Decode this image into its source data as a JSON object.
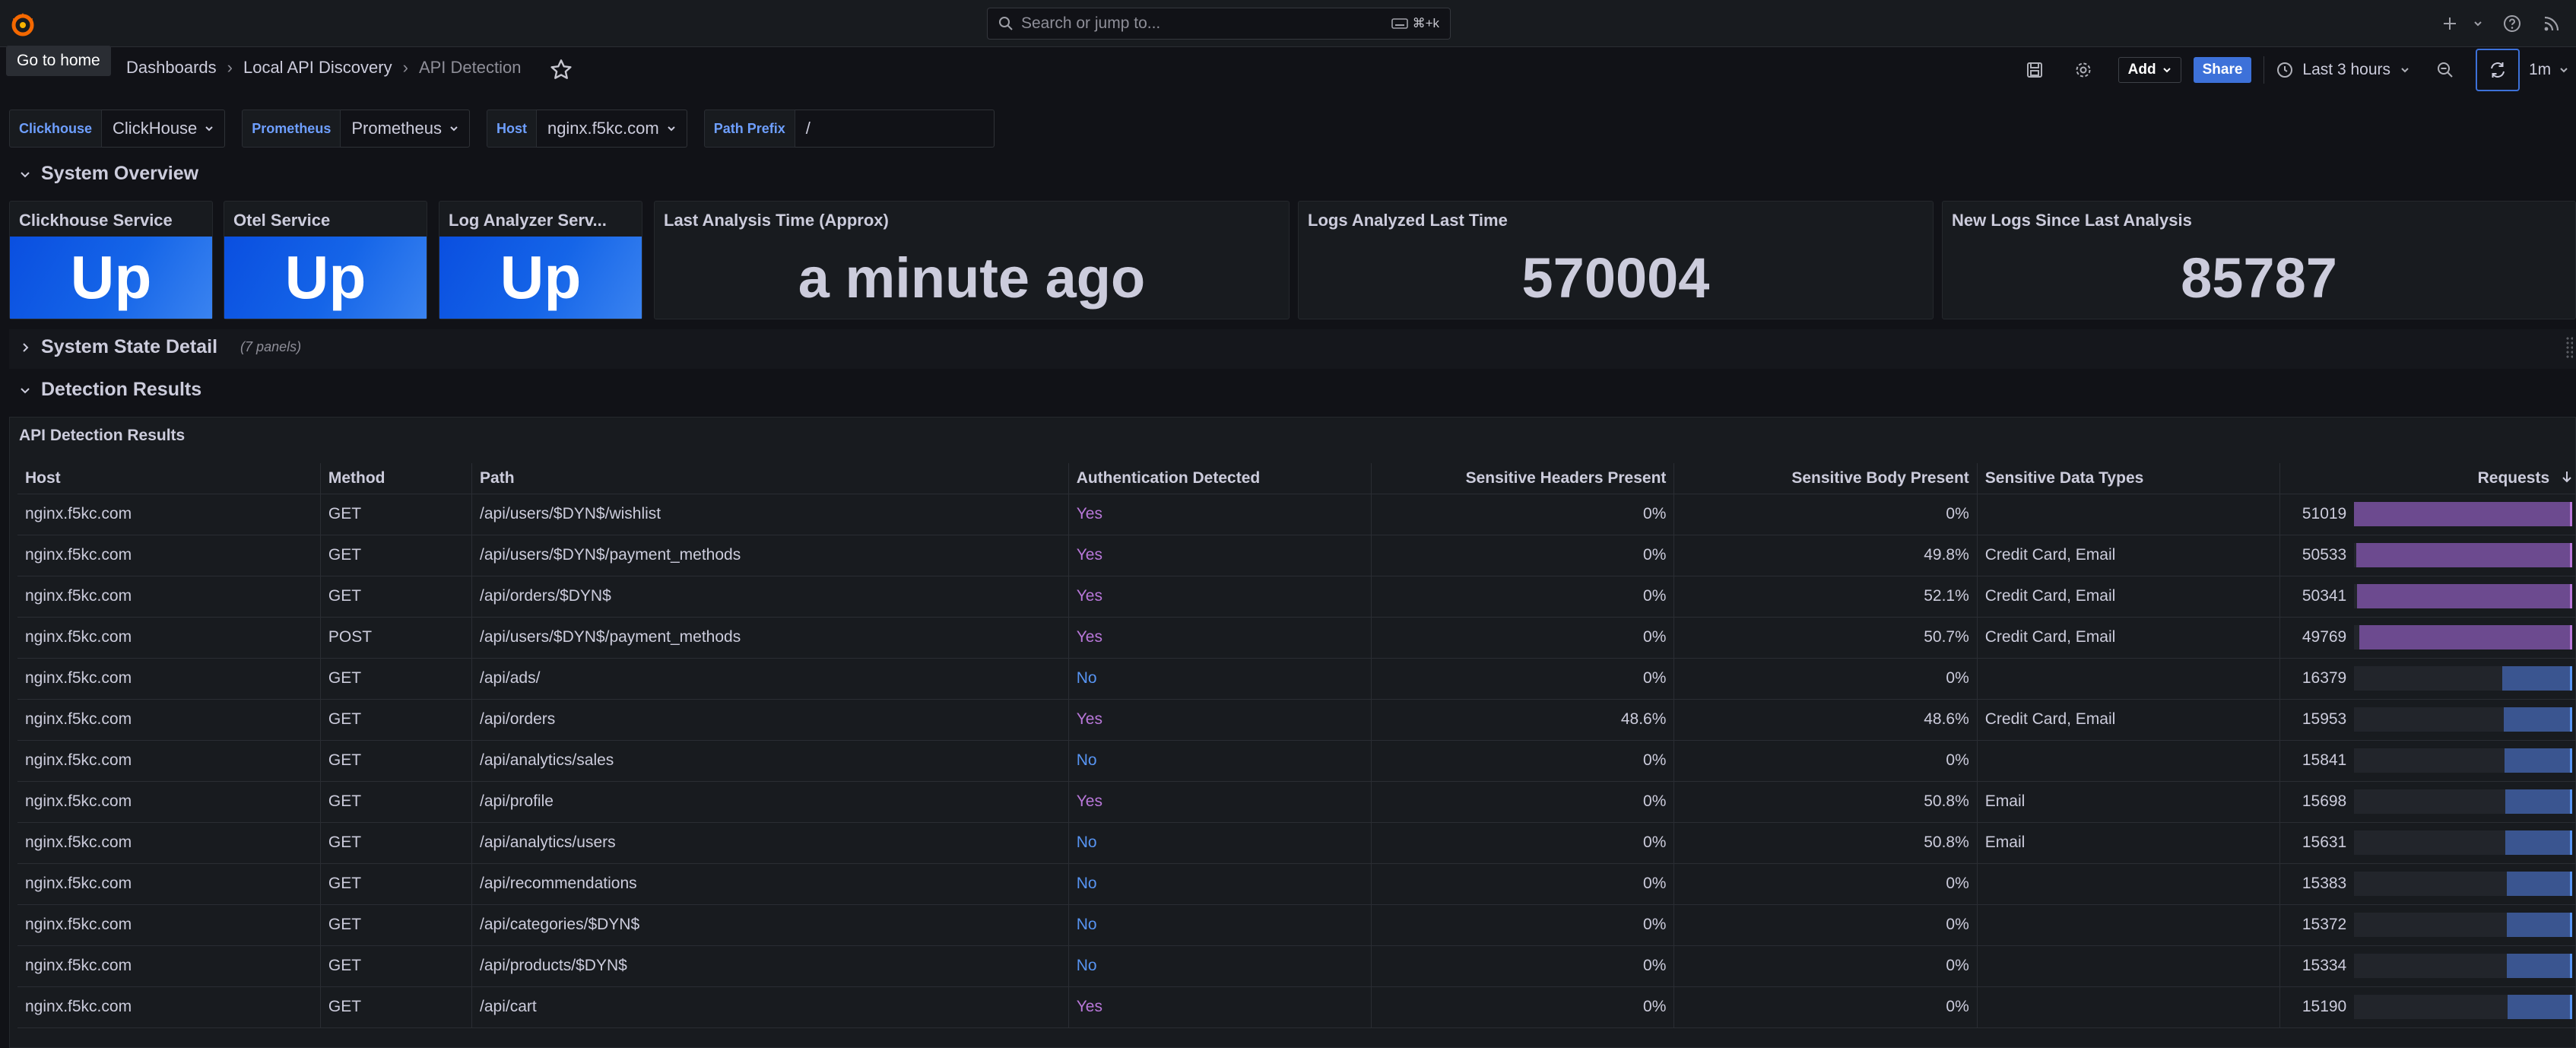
{
  "topbar": {
    "search_placeholder": "Search or jump to...",
    "search_shortcut": "⌘+k",
    "tooltip": "Go to home"
  },
  "breadcrumb": [
    "Dashboards",
    "Local API Discovery",
    "API Detection"
  ],
  "toolbar": {
    "add_label": "Add",
    "share_label": "Share",
    "time_range": "Last 3 hours",
    "refresh_interval": "1m"
  },
  "variables": [
    {
      "label": "Clickhouse",
      "value": "ClickHouse"
    },
    {
      "label": "Prometheus",
      "value": "Prometheus"
    },
    {
      "label": "Host",
      "value": "nginx.f5kc.com"
    },
    {
      "label": "Path Prefix",
      "value": "/"
    }
  ],
  "rows": {
    "overview": "System Overview",
    "state_detail": "System State Detail",
    "state_detail_sub": "(7 panels)",
    "detection": "Detection Results"
  },
  "stats": [
    {
      "title": "Clickhouse Service",
      "value": "Up"
    },
    {
      "title": "Otel Service",
      "value": "Up"
    },
    {
      "title": "Log Analyzer Serv...",
      "value": "Up"
    },
    {
      "title": "Last Analysis Time (Approx)",
      "value": "a minute ago"
    },
    {
      "title": "Logs Analyzed Last Time",
      "value": "570004"
    },
    {
      "title": "New Logs Since Last Analysis",
      "value": "85787"
    }
  ],
  "table": {
    "title": "API Detection Results",
    "columns": [
      "Host",
      "Method",
      "Path",
      "Authentication Detected",
      "Sensitive Headers Present",
      "Sensitive Body Present",
      "Sensitive Data Types",
      "Requests"
    ],
    "rows": [
      [
        "nginx.f5kc.com",
        "GET",
        "/api/users/$DYN$/wishlist",
        "Yes",
        "0%",
        "0%",
        "",
        51019
      ],
      [
        "nginx.f5kc.com",
        "GET",
        "/api/users/$DYN$/payment_methods",
        "Yes",
        "0%",
        "49.8%",
        "Credit Card, Email",
        50533
      ],
      [
        "nginx.f5kc.com",
        "GET",
        "/api/orders/$DYN$",
        "Yes",
        "0%",
        "52.1%",
        "Credit Card, Email",
        50341
      ],
      [
        "nginx.f5kc.com",
        "POST",
        "/api/users/$DYN$/payment_methods",
        "Yes",
        "0%",
        "50.7%",
        "Credit Card, Email",
        49769
      ],
      [
        "nginx.f5kc.com",
        "GET",
        "/api/ads/",
        "No",
        "0%",
        "0%",
        "",
        16379
      ],
      [
        "nginx.f5kc.com",
        "GET",
        "/api/orders",
        "Yes",
        "48.6%",
        "48.6%",
        "Credit Card, Email",
        15953
      ],
      [
        "nginx.f5kc.com",
        "GET",
        "/api/analytics/sales",
        "No",
        "0%",
        "0%",
        "",
        15841
      ],
      [
        "nginx.f5kc.com",
        "GET",
        "/api/profile",
        "Yes",
        "0%",
        "50.8%",
        "Email",
        15698
      ],
      [
        "nginx.f5kc.com",
        "GET",
        "/api/analytics/users",
        "No",
        "0%",
        "50.8%",
        "Email",
        15631
      ],
      [
        "nginx.f5kc.com",
        "GET",
        "/api/recommendations",
        "No",
        "0%",
        "0%",
        "",
        15383
      ],
      [
        "nginx.f5kc.com",
        "GET",
        "/api/categories/$DYN$",
        "No",
        "0%",
        "0%",
        "",
        15372
      ],
      [
        "nginx.f5kc.com",
        "GET",
        "/api/products/$DYN$",
        "No",
        "0%",
        "0%",
        "",
        15334
      ],
      [
        "nginx.f5kc.com",
        "GET",
        "/api/cart",
        "Yes",
        "0%",
        "0%",
        "",
        15190
      ]
    ],
    "bar_max": 51019,
    "bar_colors": {
      "high": "#6c4a8f",
      "high_edge": "#b877d9",
      "low": "#3a5590",
      "low_edge": "#5794f2"
    },
    "auth_colors": {
      "Yes": "#b877d9",
      "No": "#5794f2"
    }
  }
}
